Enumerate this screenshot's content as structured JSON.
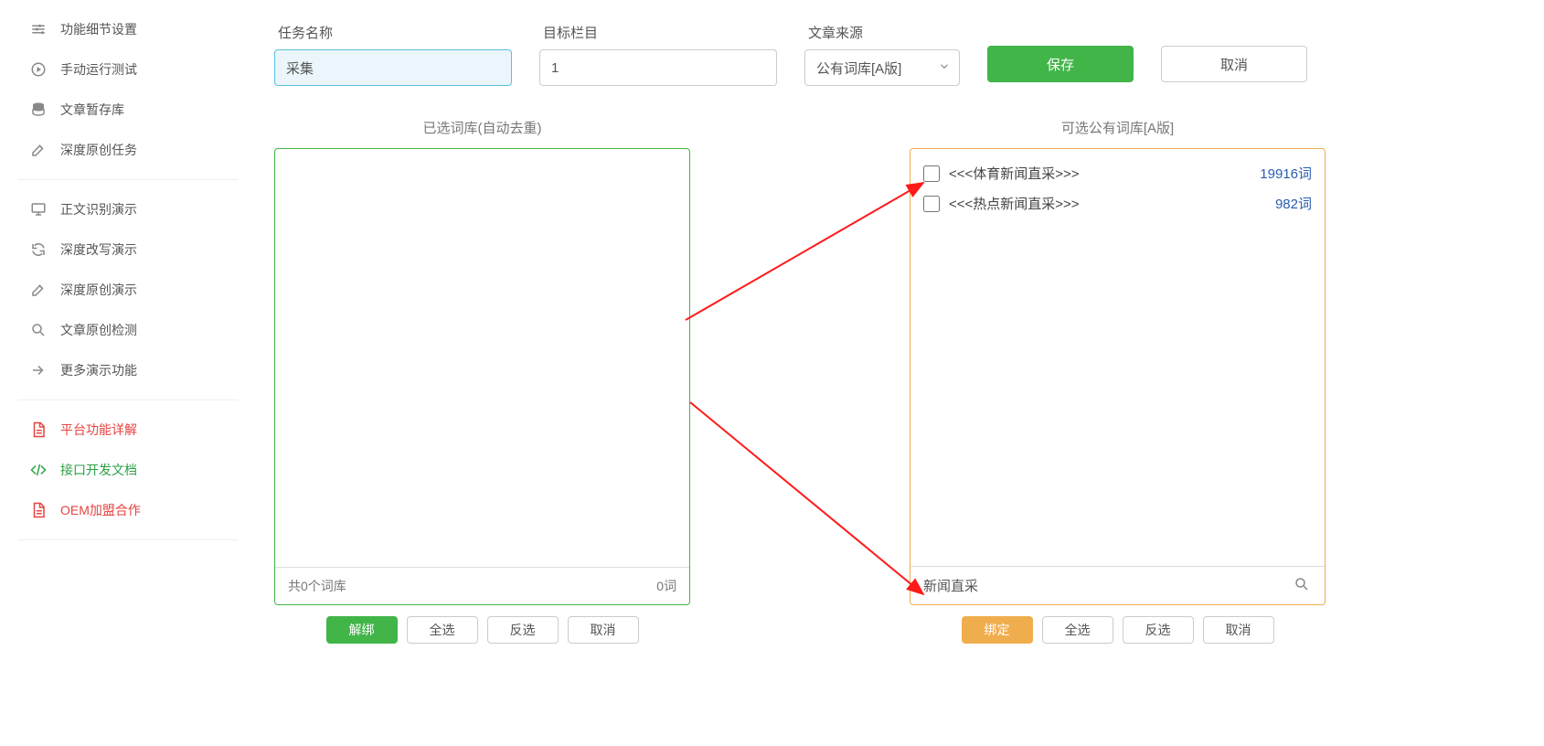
{
  "sidebar": {
    "group1": [
      {
        "id": "detail-settings",
        "label": "功能细节设置"
      },
      {
        "id": "manual-run-test",
        "label": "手动运行测试"
      },
      {
        "id": "article-temp-store",
        "label": "文章暂存库"
      },
      {
        "id": "deep-original-task",
        "label": "深度原创任务"
      }
    ],
    "group2": [
      {
        "id": "body-recognition-demo",
        "label": "正文识别演示"
      },
      {
        "id": "deep-rewrite-demo",
        "label": "深度改写演示"
      },
      {
        "id": "deep-original-demo",
        "label": "深度原创演示"
      },
      {
        "id": "article-original-check",
        "label": "文章原创检测"
      },
      {
        "id": "more-demo-features",
        "label": "更多演示功能"
      }
    ],
    "group3": [
      {
        "id": "platform-guide",
        "label": "平台功能详解",
        "cls": "red"
      },
      {
        "id": "api-dev-docs",
        "label": "接口开发文档",
        "cls": "green"
      },
      {
        "id": "oem-cooperation",
        "label": "OEM加盟合作",
        "cls": "red"
      }
    ]
  },
  "form": {
    "task_name_label": "任务名称",
    "task_name_value": "采集",
    "target_column_label": "目标栏目",
    "target_column_value": "1",
    "article_source_label": "文章来源",
    "article_source_value": "公有词库[A版]",
    "save_label": "保存",
    "cancel_label": "取消"
  },
  "left_panel": {
    "title": "已选词库(自动去重)",
    "summary_left": "共0个词库",
    "summary_right": "0词",
    "actions": {
      "unbind": "解绑",
      "select_all": "全选",
      "invert": "反选",
      "cancel": "取消"
    }
  },
  "right_panel": {
    "title": "可选公有词库[A版]",
    "items": [
      {
        "label": "<<<体育新闻直采>>>",
        "count": "19916词"
      },
      {
        "label": "<<<热点新闻直采>>>",
        "count": "982词"
      }
    ],
    "search_value": "新闻直采",
    "actions": {
      "bind": "绑定",
      "select_all": "全选",
      "invert": "反选",
      "cancel": "取消"
    }
  }
}
